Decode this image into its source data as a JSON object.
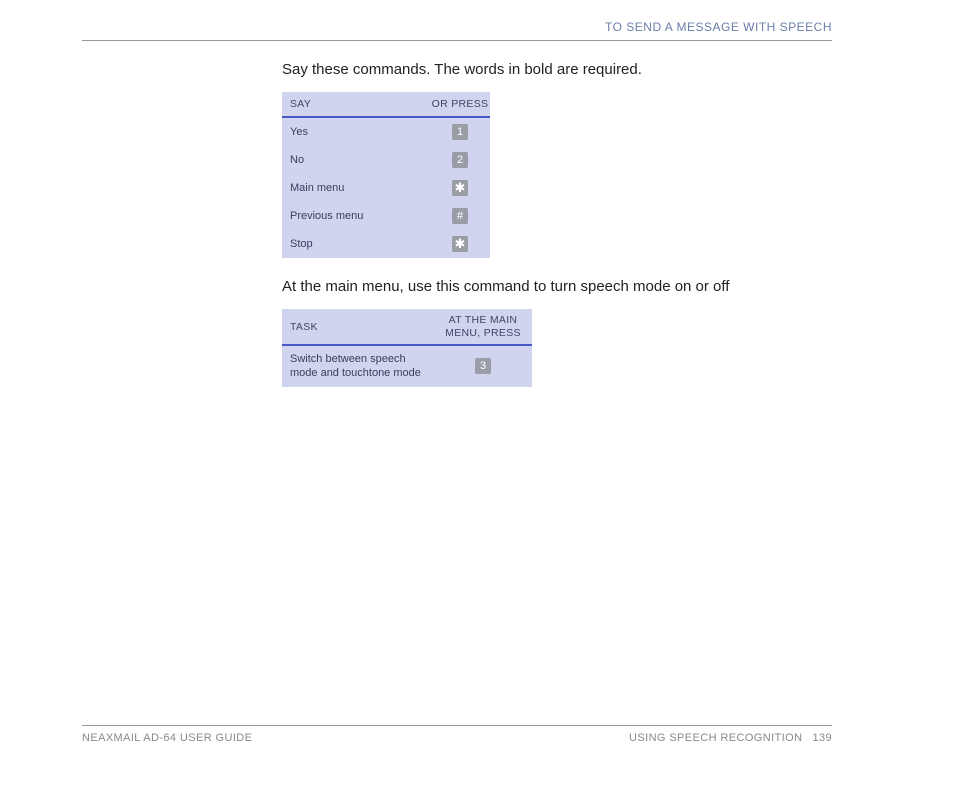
{
  "header": {
    "section_title": "TO SEND A MESSAGE WITH SPEECH"
  },
  "body": {
    "intro1": "Say these commands. The words in bold are required.",
    "table1": {
      "col_say": "SAY",
      "col_press": "OR PRESS",
      "rows": [
        {
          "say": "Yes",
          "key": "1",
          "key_class": ""
        },
        {
          "say": "No",
          "key": "2",
          "key_class": ""
        },
        {
          "say": "Main menu",
          "key": "✱",
          "key_class": "star"
        },
        {
          "say": "Previous menu",
          "key": "#",
          "key_class": ""
        },
        {
          "say": "Stop",
          "key": "✱",
          "key_class": "star"
        }
      ]
    },
    "intro2": "At the main menu, use this command to turn speech mode on or off",
    "table2": {
      "col_task": "TASK",
      "col_press_line1": "AT THE MAIN",
      "col_press_line2": "MENU, PRESS",
      "row": {
        "task": "Switch between speech mode and touchtone mode",
        "key": "3"
      }
    }
  },
  "footer": {
    "left": "NEAXMAIL AD-64 USER GUIDE",
    "right_label": "USING SPEECH RECOGNITION",
    "page": "139"
  }
}
